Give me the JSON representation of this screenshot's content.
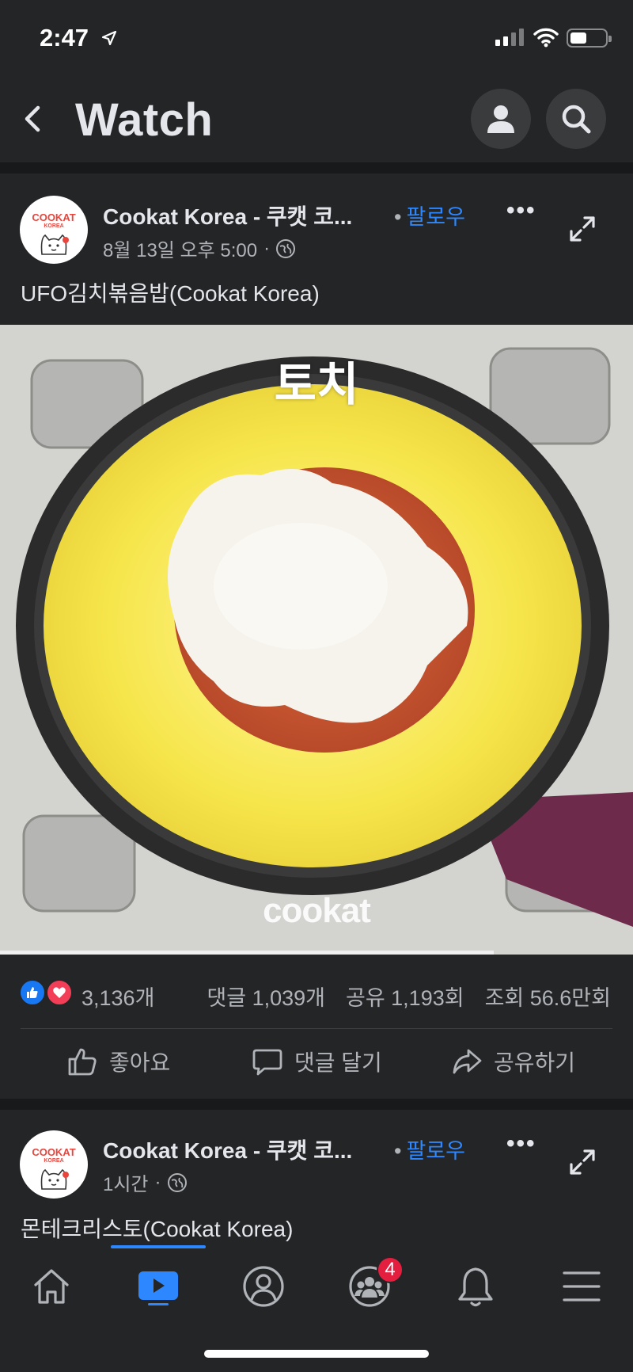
{
  "status_bar": {
    "time": "2:47"
  },
  "header": {
    "title": "Watch"
  },
  "posts": [
    {
      "page_name": "Cookat Korea - 쿠캣 코...",
      "follow_label": "팔로우",
      "timestamp": "8월 13일 오후 5:00",
      "caption": "UFO김치볶음밥(Cookat Korea)",
      "avatar_text": "COOKAT",
      "avatar_subtext": "KOREA"
    },
    {
      "page_name": "Cookat Korea - 쿠캣 코...",
      "follow_label": "팔로우",
      "timestamp": "1시간",
      "caption": "몬테크리스토(Cookat Korea)",
      "avatar_text": "COOKAT",
      "avatar_subtext": "KOREA"
    }
  ],
  "video": {
    "caption": "토치",
    "watermark": "cookat",
    "progress_fraction": 0.78
  },
  "engagement": {
    "reaction_count": "3,136개",
    "comments": "댓글 1,039개",
    "shares": "공유 1,193회",
    "views": "조회 56.6만회"
  },
  "actions": {
    "like": "좋아요",
    "comment": "댓글 달기",
    "share": "공유하기"
  },
  "tabbar": {
    "groups_badge": "4"
  },
  "colors": {
    "background": "#242526",
    "accent": "#2d88ff",
    "badge": "#e41e3f"
  }
}
